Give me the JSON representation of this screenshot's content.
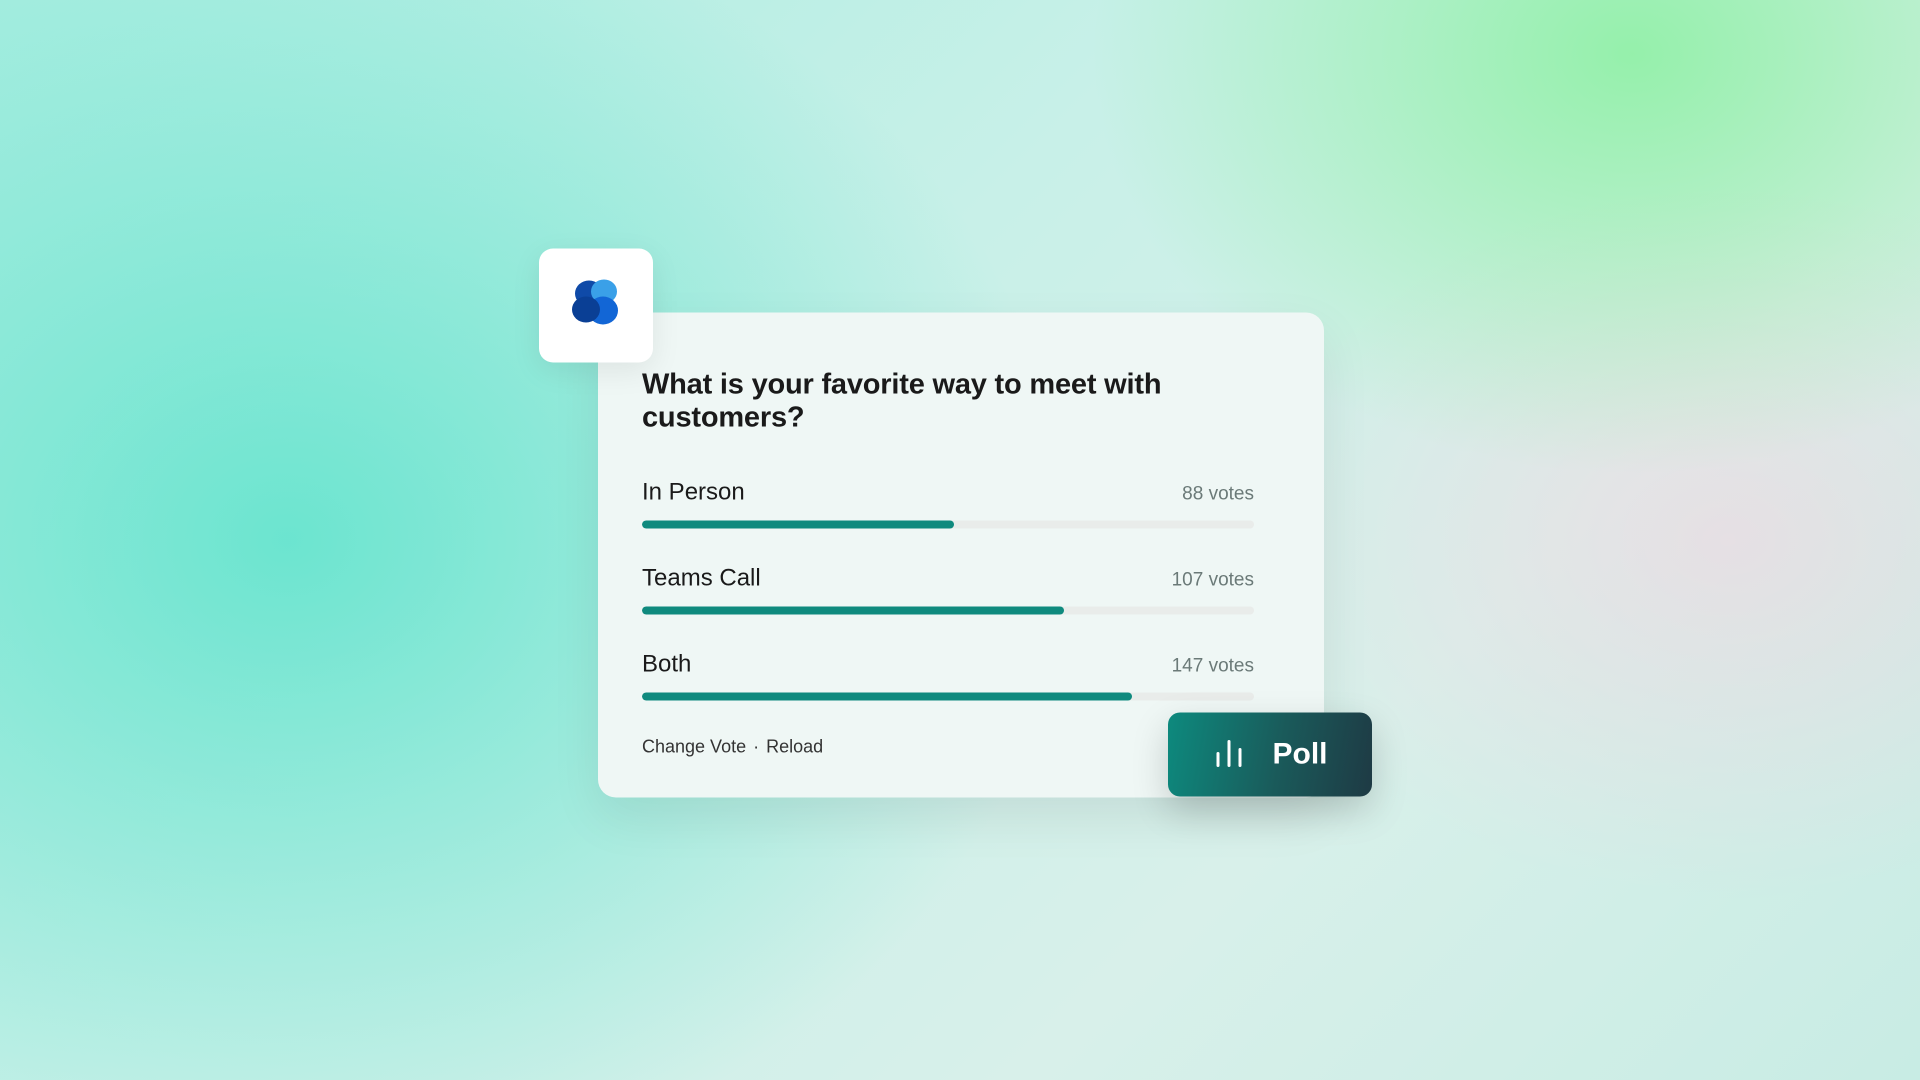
{
  "poll": {
    "question": "What is your favorite way to meet with customers?",
    "options": [
      {
        "label": "In Person",
        "votes": 88,
        "vote_text": "88 votes",
        "percent": 51
      },
      {
        "label": "Teams Call",
        "votes": 107,
        "vote_text": "107 votes",
        "percent": 69
      },
      {
        "label": "Both",
        "votes": 147,
        "vote_text": "147 votes",
        "percent": 80
      }
    ],
    "actions": {
      "change_vote": "Change Vote",
      "separator": "·",
      "reload": "Reload"
    }
  },
  "poll_button": {
    "label": "Poll"
  },
  "colors": {
    "bar_fill": "#0f8a7e",
    "bar_track": "#e9ecea",
    "card_bg": "#eff7f5"
  },
  "chart_data": {
    "type": "bar",
    "title": "What is your favorite way to meet with customers?",
    "categories": [
      "In Person",
      "Teams Call",
      "Both"
    ],
    "values": [
      88,
      107,
      147
    ],
    "xlabel": "",
    "ylabel": "votes"
  }
}
